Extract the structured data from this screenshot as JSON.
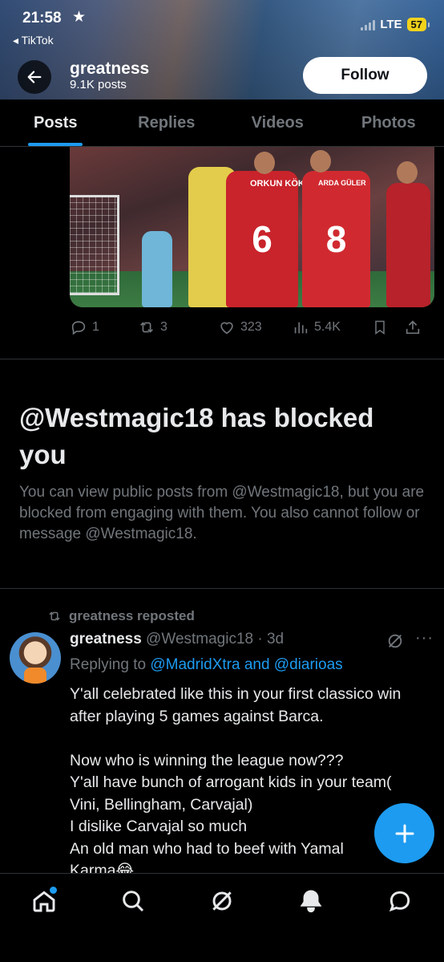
{
  "status_bar": {
    "time": "21:58",
    "back_app": "◂ TikTok",
    "network": "LTE",
    "battery": "57"
  },
  "header": {
    "name": "greatness",
    "post_count": "9.1K posts",
    "follow_label": "Follow"
  },
  "tabs": [
    {
      "label": "Posts",
      "active": true
    },
    {
      "label": "Replies",
      "active": false
    },
    {
      "label": "Videos",
      "active": false
    },
    {
      "label": "Photos",
      "active": false
    }
  ],
  "media": {
    "jersey_name_1": "ORKUN KÖKÇÜ",
    "jersey_number_1": "6",
    "jersey_name_2": "ARDA GÜLER",
    "jersey_number_2": "8"
  },
  "post_actions": {
    "replies": "1",
    "reposts": "3",
    "likes": "323",
    "views": "5.4K"
  },
  "blocked_notice": {
    "title": "@Westmagic18 has blocked you",
    "description": "You can view public posts from @Westmagic18, but you are blocked from engaging with them. You also cannot follow or message @Westmagic18."
  },
  "repost": {
    "label": "greatness reposted",
    "author_name": "greatness",
    "author_meta": " @Westmagic18 · 3d",
    "replying_prefix": "Replying to ",
    "replying_targets": "@MadridXtra and @diarioas",
    "body": "Y'all celebrated like this in your first classico win after playing 5 games against Barca.\n\nNow who is winning the league now???\nY'all have bunch of arrogant kids in your team( Vini, Bellingham, Carvajal)\nI dislike Carvajal so much\nAn old man who had to beef with Yamal\nKarma😂"
  },
  "nav": [
    "home-icon",
    "search-icon",
    "grok-icon",
    "notifications-icon",
    "messages-icon"
  ],
  "colors": {
    "accent": "#1d9bf0",
    "background": "#000000",
    "muted": "#71767b",
    "text": "#e7e9ea"
  }
}
